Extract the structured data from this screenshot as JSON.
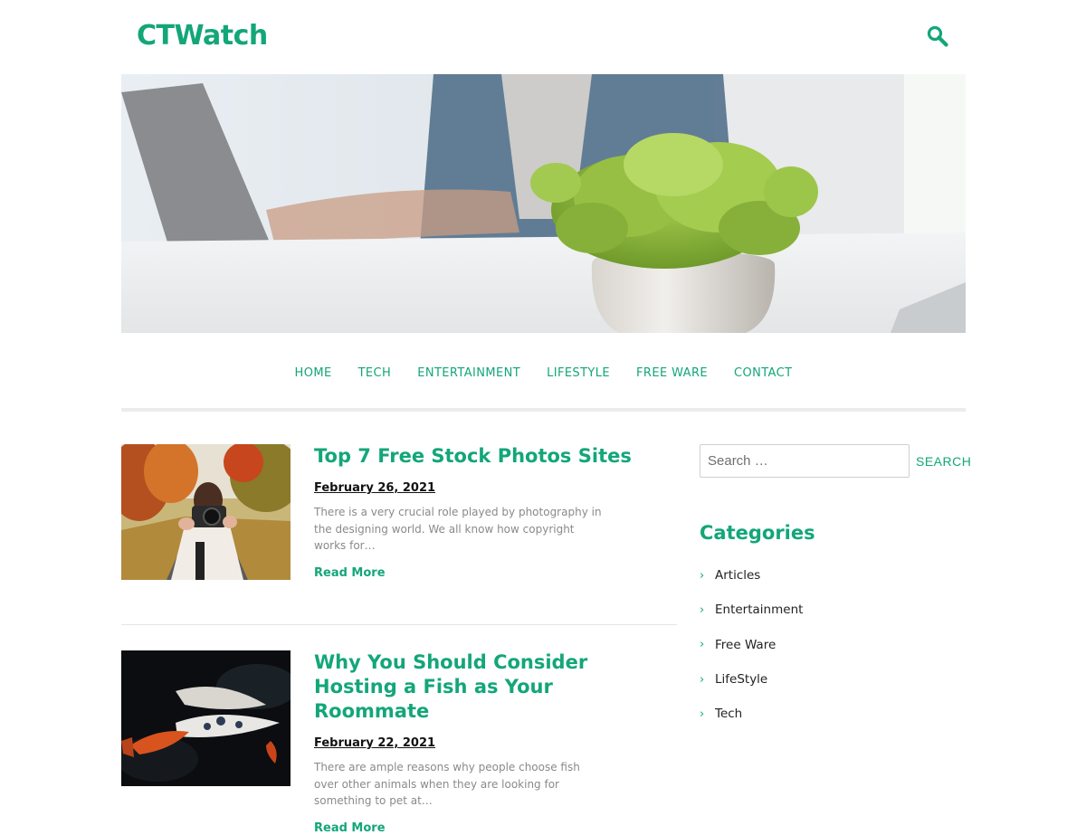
{
  "header": {
    "site_title": "CTWatch",
    "search_icon": "search-icon"
  },
  "hero": {
    "image": "desk-laptop-plant-photo"
  },
  "nav": {
    "items": [
      "HOME",
      "TECH",
      "ENTERTAINMENT",
      "LIFESTYLE",
      "FREE WARE",
      "CONTACT"
    ]
  },
  "posts": [
    {
      "title": "Top 7 Free Stock Photos Sites",
      "date": "February 26, 2021",
      "excerpt": "There is a very crucial role played by photography in the designing world. We all know how copyright works for…",
      "read_more": "Read More",
      "thumb": "woman-with-camera-photo"
    },
    {
      "title": "Why You Should Consider Hosting a Fish as Your Roommate",
      "date": "February 22, 2021",
      "excerpt": "There are ample reasons why people choose fish over other animals when they are looking for something to pet at…",
      "read_more": "Read More",
      "thumb": "koi-fish-photo"
    }
  ],
  "sidebar": {
    "search_placeholder": "Search …",
    "search_button": "SEARCH",
    "categories_title": "Categories",
    "categories": [
      "Articles",
      "Entertainment",
      "Free Ware",
      "LifeStyle",
      "Tech"
    ]
  },
  "colors": {
    "accent": "#13a679",
    "text": "#222222",
    "muted": "#8a8a8a"
  }
}
